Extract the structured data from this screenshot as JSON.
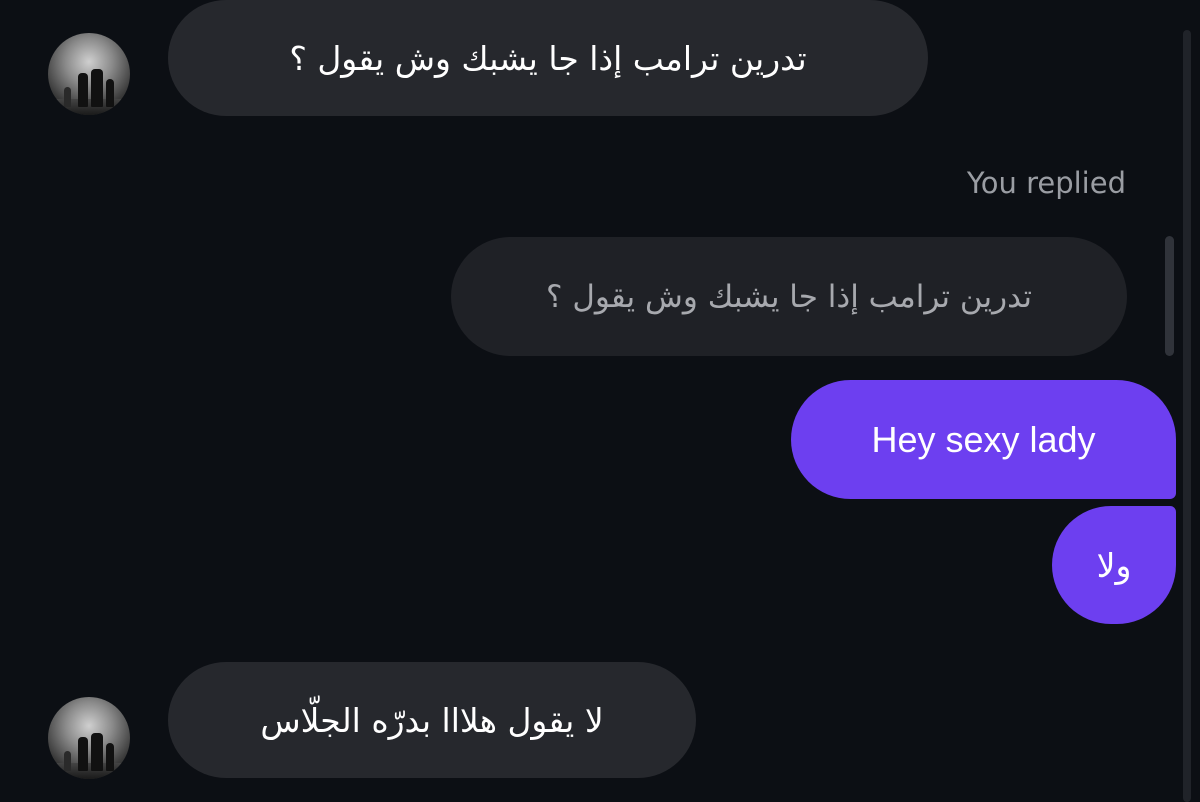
{
  "conversation": {
    "messages": [
      {
        "sender": "them",
        "text": "تدرين ترامب إذا جا يشبك وش يقول ؟"
      },
      {
        "sender": "me",
        "context_label": "You replied",
        "quoted_text": "تدرين ترامب إذا جا يشبك وش يقول ؟",
        "text": "Hey sexy lady"
      },
      {
        "sender": "me",
        "text": "ولا"
      },
      {
        "sender": "them",
        "text": "لا يقول هلااا بدرّه الجلّاس"
      }
    ]
  },
  "colors": {
    "background": "#0c0f14",
    "incoming_bubble": "#26282d",
    "quoted_bubble": "#1f2126",
    "outgoing_bubble": "#6d3ff0",
    "muted_text": "#9a9da3"
  },
  "icons": {
    "avatar": "user-avatar-photo"
  }
}
